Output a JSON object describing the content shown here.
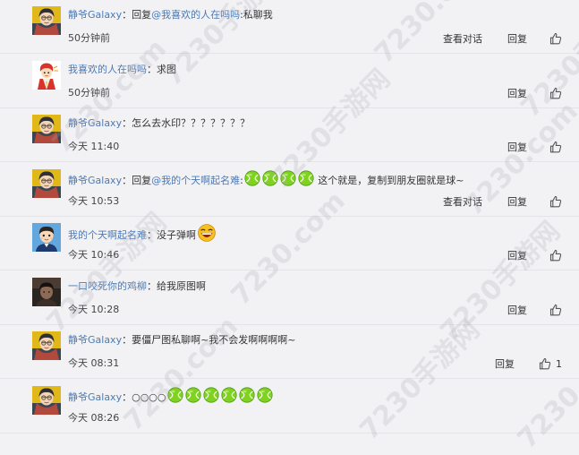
{
  "comments": [
    {
      "user": "静爷Galaxy",
      "sep": "：",
      "parts": [
        {
          "t": "回复"
        },
        {
          "t": "@我喜欢的人在吗吗",
          "link": true
        },
        {
          "t": ":私聊我"
        }
      ],
      "time": "50分钟前",
      "view": "查看对话",
      "reply": "回复",
      "like": ""
    },
    {
      "user": "我喜欢的人在吗吗",
      "sep": "：",
      "parts": [
        {
          "t": "求图"
        }
      ],
      "time": "50分钟前",
      "view": "",
      "reply": "回复",
      "like": ""
    },
    {
      "user": "静爷Galaxy",
      "sep": "：",
      "parts": [
        {
          "t": "怎么去水印？？？？？？？"
        }
      ],
      "time": "今天 11:40",
      "view": "",
      "reply": "回复",
      "like": ""
    },
    {
      "user": "静爷Galaxy",
      "sep": "：",
      "parts": [
        {
          "t": "回复"
        },
        {
          "t": "@我的个天啊起名难",
          "link": true
        },
        {
          "t": ":"
        },
        {
          "emoji": "ball"
        },
        {
          "emoji": "ball"
        },
        {
          "emoji": "ball"
        },
        {
          "emoji": "ball"
        },
        {
          "t": " 这个就是，复制到朋友圈就是球~"
        }
      ],
      "time": "今天 10:53",
      "view": "查看对话",
      "reply": "回复",
      "like": ""
    },
    {
      "user": "我的个天啊起名难",
      "sep": "：",
      "parts": [
        {
          "t": "没子弹啊"
        },
        {
          "emoji": "laugh"
        }
      ],
      "time": "今天 10:46",
      "view": "",
      "reply": "回复",
      "like": ""
    },
    {
      "user": "一口咬死你的鸡柳",
      "sep": "：",
      "parts": [
        {
          "t": "给我原图啊"
        }
      ],
      "time": "今天 10:28",
      "view": "",
      "reply": "回复",
      "like": ""
    },
    {
      "user": "静爷Galaxy",
      "sep": "：",
      "parts": [
        {
          "t": "要僵尸图私聊啊~我不会发啊啊啊啊~"
        }
      ],
      "time": "今天 08:31",
      "view": "",
      "reply": "回复",
      "like": "1"
    },
    {
      "user": "静爷Galaxy",
      "sep": "：",
      "parts": [
        {
          "t": "○○○○"
        },
        {
          "emoji": "ball"
        },
        {
          "emoji": "ball"
        },
        {
          "emoji": "ball"
        },
        {
          "emoji": "ball"
        },
        {
          "emoji": "ball"
        },
        {
          "emoji": "ball"
        }
      ],
      "time": "今天 08:26",
      "view": "",
      "reply": "",
      "like": ""
    }
  ],
  "avatars": [
    "galaxy",
    "red-cartoon",
    "galaxy",
    "galaxy",
    "boy-cartoon",
    "photo-dark",
    "galaxy",
    "galaxy"
  ],
  "watermark": "7230手游网",
  "watermark_domain": "7230.com",
  "colors": {
    "username": "#4a7ab8",
    "background": "#f2f2f5",
    "separator": "#e3e3e8",
    "ball": "#7fd320"
  }
}
